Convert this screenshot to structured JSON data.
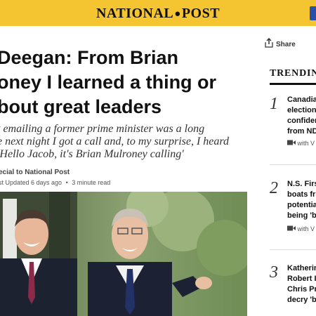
{
  "brand": {
    "name_left": "NATIONAL",
    "name_right": "POST",
    "mark": "●"
  },
  "article": {
    "headline_lines": [
      " Deegan: From Brian",
      "oney I learned a thing or",
      "bout great leaders"
    ],
    "subhead_lines": [
      "t emailing a former prime minister was a long",
      "e next night I got a call and, to my surprise, I heard",
      "'Hello Jacob, it's Brian Mulroney calling'"
    ],
    "byline": "ecial to National Post",
    "updated": "st Updated 6 days ago",
    "separator": "•",
    "read_time": "3 minute read",
    "share_label": "Share"
  },
  "trending": {
    "title": "TRENDIN",
    "items": [
      {
        "number": "1",
        "lines": [
          "Canadia",
          "election",
          "confider",
          "from ND"
        ],
        "video": "with V"
      },
      {
        "number": "2",
        "lines": [
          "N.S. Firs",
          "boats fr",
          "potentia",
          "being 'b"
        ],
        "video": "with V"
      },
      {
        "number": "3",
        "lines": [
          "Katherin",
          "Robert I",
          "Chris Pr",
          "decry 'b"
        ],
        "video": ""
      }
    ]
  },
  "colors": {
    "topbar": "#f5c531",
    "accent": "#2a4fa8"
  },
  "icons": {
    "share": "share-icon",
    "video": "video-camera-icon"
  }
}
